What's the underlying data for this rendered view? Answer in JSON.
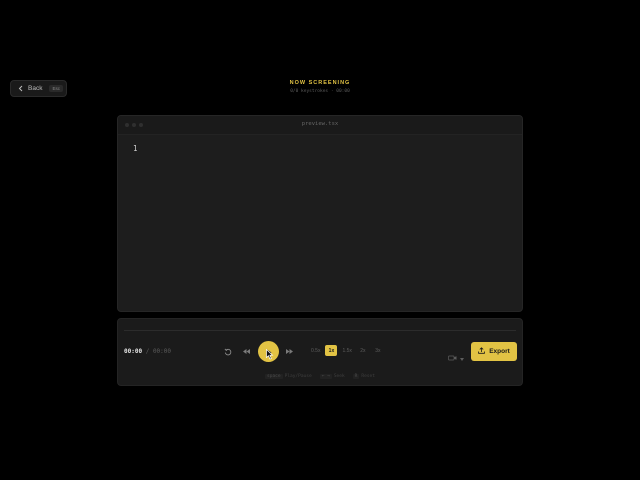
{
  "nav": {
    "back_label": "Back",
    "back_shortcut": "Esc"
  },
  "header": {
    "title": "NOW SCREENING",
    "subtitle": "0/0 keystrokes · 00:00"
  },
  "editor": {
    "filename": "preview.tsx",
    "line_numbers": [
      "1"
    ]
  },
  "player": {
    "current_time": "00:00",
    "separator": "/",
    "duration": "00:00",
    "progress": 0,
    "speeds": [
      "0.5x",
      "1x",
      "1.5x",
      "2x",
      "3x"
    ],
    "active_speed": "1x",
    "export_label": "Export",
    "hints": [
      {
        "key": "space",
        "label": "Play/Pause"
      },
      {
        "key": "← →",
        "label": "Seek"
      },
      {
        "key": "R",
        "label": "Reset"
      }
    ]
  },
  "colors": {
    "accent": "#e2c344",
    "background": "#000000",
    "panel": "#1b1b1b"
  }
}
